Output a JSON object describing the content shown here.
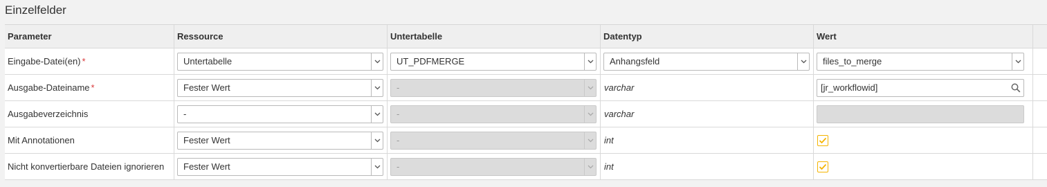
{
  "section": {
    "title": "Einzelfelder"
  },
  "headers": {
    "parameter": "Parameter",
    "ressource": "Ressource",
    "untertabelle": "Untertabelle",
    "datentyp": "Datentyp",
    "wert": "Wert"
  },
  "rows": [
    {
      "parameter": "Eingabe-Datei(en)",
      "required": "*",
      "ressource": "Untertabelle",
      "untertabelle": "UT_PDFMERGE",
      "datentyp": "Anhangsfeld",
      "wert": "files_to_merge"
    },
    {
      "parameter": "Ausgabe-Dateiname",
      "required": "*",
      "ressource": "Fester Wert",
      "untertabelle": "-",
      "datentyp": "varchar",
      "wert": "[jr_workflowid]"
    },
    {
      "parameter": "Ausgabeverzeichnis",
      "ressource": "-",
      "untertabelle": "-",
      "datentyp": "varchar",
      "wert": ""
    },
    {
      "parameter": "Mit Annotationen",
      "ressource": "Fester Wert",
      "untertabelle": "-",
      "datentyp": "int",
      "wert_checked": true
    },
    {
      "parameter": "Nicht konvertierbare Dateien ignorieren",
      "ressource": "Fester Wert",
      "untertabelle": "-",
      "datentyp": "int",
      "wert_checked": true
    }
  ],
  "colors": {
    "required": "#d9383a",
    "checkbox": "#f5b400",
    "disabled_bg": "#dcdcdc"
  },
  "icons": {
    "dropdown": "chevron-down-icon",
    "search": "search-icon",
    "check": "check-icon"
  }
}
